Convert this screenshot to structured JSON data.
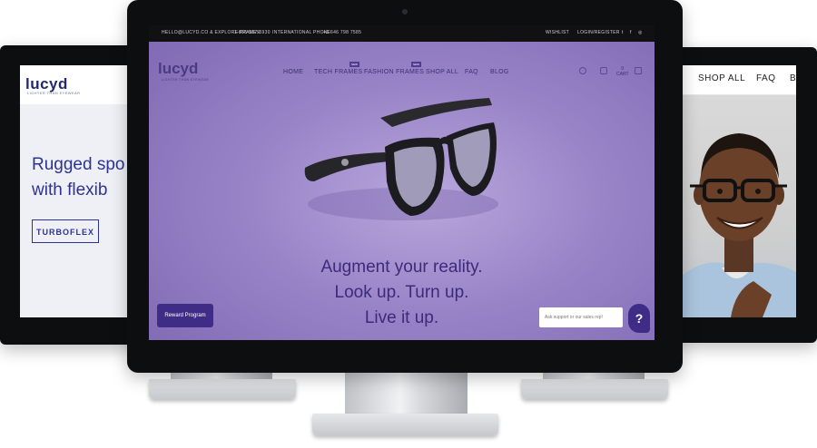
{
  "left_site": {
    "logo": "lucyd",
    "logo_sub": "LIGHTER THAN EYEWEAR",
    "headline_1": "Rugged spo",
    "headline_2": "with flexib",
    "cta": "TURBOFLEX"
  },
  "center_site": {
    "topbar": {
      "contact_1": "HELLO@LUCYD.CO & EXPLORE FRAMES",
      "contact_2": "1-855-557-5930",
      "contact_3": "INTERNATIONAL PHONE",
      "contact_4": "+1 646 798 7585",
      "wishlist": "WISHLIST",
      "login": "LOGIN/REGISTER"
    },
    "logo": "lucyd",
    "logo_sub": "LIGHTER THAN EYEWEAR",
    "nav": [
      {
        "label": "HOME"
      },
      {
        "label": "TECH FRAMES",
        "badge": "NEW"
      },
      {
        "label": "FASHION FRAMES",
        "badge": "NEW"
      },
      {
        "label": "SHOP ALL"
      },
      {
        "label": "FAQ"
      },
      {
        "label": "BLOG"
      }
    ],
    "cart_label": "CART",
    "cart_count": "0",
    "tagline": [
      "Augment your reality.",
      "Look up. Turn up.",
      "Live it up."
    ],
    "reward_button": "Reward Program",
    "support_placeholder": "Ask support or our sales rep!",
    "help_button": "?"
  },
  "right_site": {
    "nav": [
      "SHOP ALL",
      "FAQ",
      "B"
    ]
  },
  "colors": {
    "brand_purple": "#3f2c87",
    "hero_lavender": "#9a84c8",
    "left_brand_navy": "#2e3392"
  }
}
